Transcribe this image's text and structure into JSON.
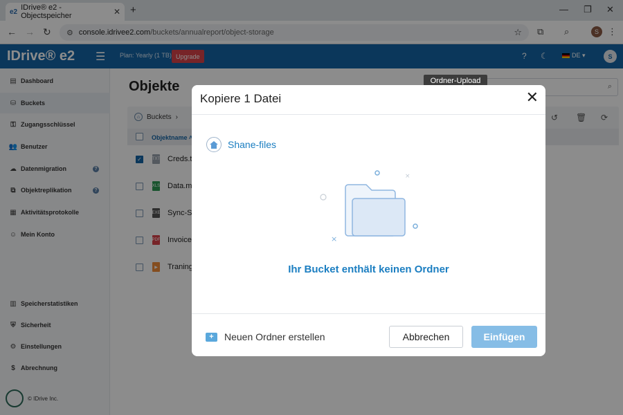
{
  "browser": {
    "tab_title": "IDrive® e2 - Objectspeicher",
    "tab_favicon": "e2",
    "url_host": "console.idrivee2.com",
    "url_path": "/buckets/annualreport/object-storage",
    "profile_initial": "S"
  },
  "header": {
    "logo": "IDrive® e2",
    "plan": "Plan: Yearly (1 TB)",
    "upgrade": "Upgrade",
    "language": "DE",
    "user_initial": "S"
  },
  "sidebar": {
    "items": [
      {
        "label": "Dashboard",
        "icon": "dashboard-icon"
      },
      {
        "label": "Buckets",
        "icon": "bucket-icon"
      },
      {
        "label": "Zugangsschlüssel",
        "icon": "key-icon"
      },
      {
        "label": "Benutzer",
        "icon": "users-icon"
      },
      {
        "label": "Datenmigration",
        "icon": "cloud-migration-icon"
      },
      {
        "label": "Objektreplikation",
        "icon": "replication-icon"
      },
      {
        "label": "Aktivitätsprotokolle",
        "icon": "log-icon"
      },
      {
        "label": "Mein Konto",
        "icon": "account-icon"
      }
    ],
    "bottom_items": [
      {
        "label": "Speicherstatistiken",
        "icon": "stats-icon"
      },
      {
        "label": "Sicherheit",
        "icon": "shield-icon"
      },
      {
        "label": "Einstellungen",
        "icon": "gear-icon"
      },
      {
        "label": "Abrechnung",
        "icon": "billing-icon"
      }
    ],
    "footer": "© IDrive Inc."
  },
  "main": {
    "title": "Objekte",
    "breadcrumb": "Buckets",
    "column_name": "Objektname",
    "tooltip": "Ordner-Upload",
    "files": [
      {
        "name": "Creds.t",
        "checked": true,
        "icon_color": "#9aa3ad"
      },
      {
        "name": "Data.m",
        "checked": false,
        "icon_color": "#2e9a55"
      },
      {
        "name": "Sync-Se",
        "checked": false,
        "icon_color": "#555555"
      },
      {
        "name": "Invoice",
        "checked": false,
        "icon_color": "#d9434a"
      },
      {
        "name": "Traning",
        "checked": false,
        "icon_color": "#f08c3a"
      }
    ]
  },
  "modal": {
    "title": "Kopiere 1 Datei",
    "breadcrumb": "Shane-files",
    "empty_message": "Ihr Bucket enthält keinen Ordner",
    "new_folder": "Neuen Ordner erstellen",
    "cancel": "Abbrechen",
    "paste": "Einfügen"
  }
}
